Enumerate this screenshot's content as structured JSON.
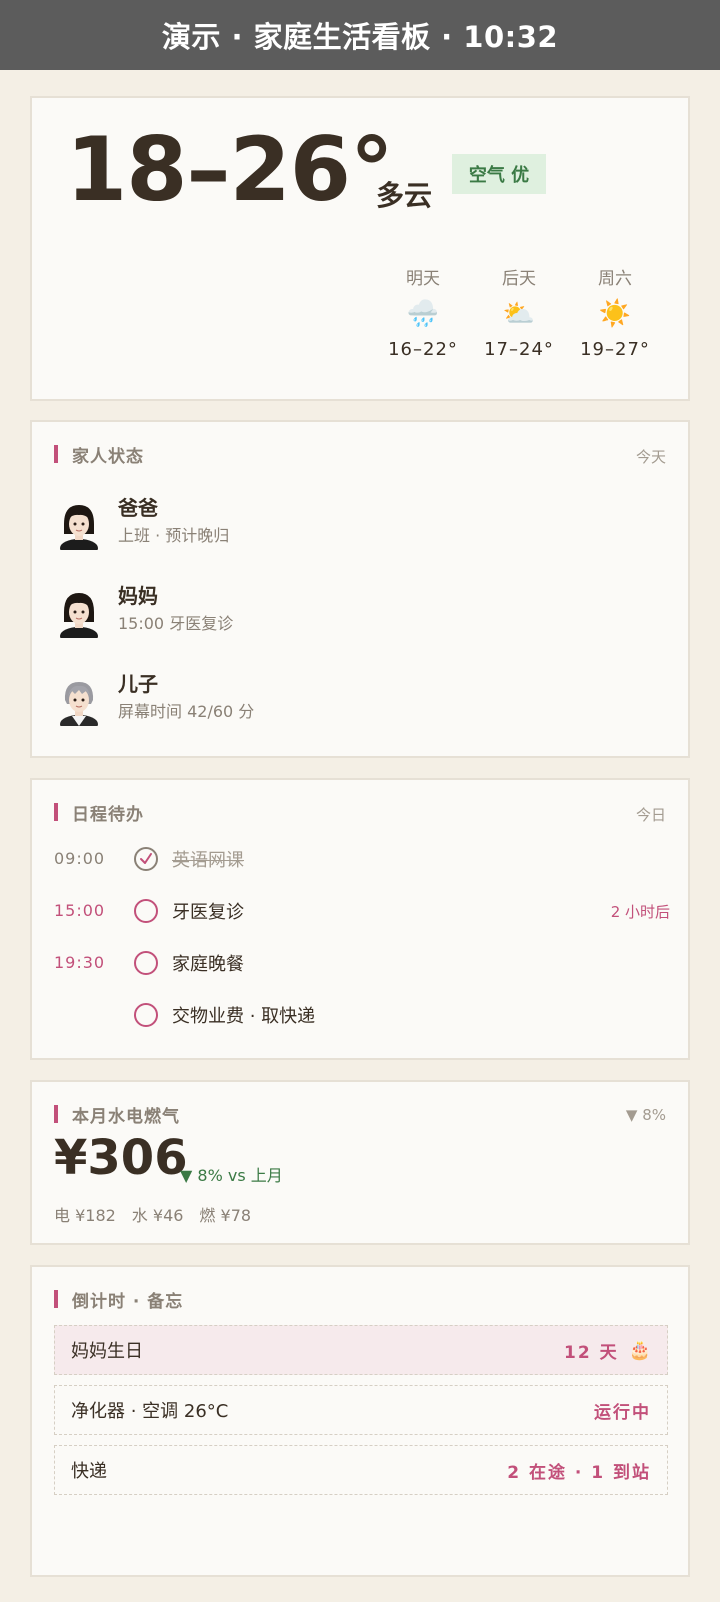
{
  "topbar": {
    "title": "演示 · 家庭生活看板 · 10:32"
  },
  "weather": {
    "temp_range": "18–26°",
    "condition": "多云",
    "aqi": "空气 优",
    "forecast": [
      {
        "day": "明天",
        "icon": "rain-cloud-icon",
        "glyph": "🌧️",
        "temp": "16–22°"
      },
      {
        "day": "后天",
        "icon": "partly-cloudy-icon",
        "glyph": "⛅",
        "temp": "17–24°"
      },
      {
        "day": "周六",
        "icon": "sun-icon",
        "glyph": "☀️",
        "temp": "19–27°"
      }
    ]
  },
  "family": {
    "title": "家人状态",
    "right": "今天",
    "members": [
      {
        "name": "爸爸",
        "status": "上班 · 预计晚归",
        "avatar": "avatar-dark-hair"
      },
      {
        "name": "妈妈",
        "status": "15:00 牙医复诊",
        "avatar": "avatar-dark-hair"
      },
      {
        "name": "儿子",
        "status": "屏幕时间 42/60 分",
        "avatar": "avatar-gray-hair"
      }
    ]
  },
  "schedule": {
    "title": "日程待办",
    "right": "今日",
    "tasks": [
      {
        "time": "09:00",
        "text": "英语网课",
        "done": true,
        "note": ""
      },
      {
        "time": "15:00",
        "text": "牙医复诊",
        "done": false,
        "note": "2 小时后"
      },
      {
        "time": "19:30",
        "text": "家庭晚餐",
        "done": false,
        "note": ""
      },
      {
        "time": "",
        "text": "交物业费 · 取快递",
        "done": false,
        "note": ""
      }
    ]
  },
  "utilities": {
    "title": "本月水电燃气",
    "right": "▼ 8%",
    "total": "¥306",
    "change": "▼ 8% vs 上月",
    "breakdown": "电 ¥182　水 ¥46　燃 ¥78"
  },
  "countdown": {
    "title": "倒计时 · 备忘",
    "rows": [
      {
        "label": "妈妈生日",
        "value": "12 天",
        "icon": "cake-icon",
        "glyph": "🎂",
        "highlight": true
      },
      {
        "label": "净化器 · 空调 26°C",
        "value": "运行中",
        "icon": "",
        "glyph": "",
        "highlight": false
      },
      {
        "label": "快递",
        "value": "2 在途 · 1 到站",
        "icon": "",
        "glyph": "",
        "highlight": false
      }
    ]
  },
  "colors": {
    "accent": "#c2507a",
    "good": "#3b7a45",
    "muted": "#8a8176",
    "topbar": "#5c5c5c",
    "background": "#f4efe5"
  }
}
